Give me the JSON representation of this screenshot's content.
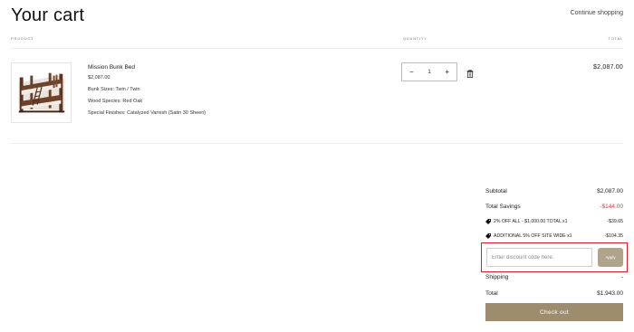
{
  "page": {
    "title": "Your cart",
    "continue_label": "Continue shopping"
  },
  "columns": {
    "product": "PRODUCT",
    "quantity": "QUANTITY",
    "total": "TOTAL"
  },
  "item": {
    "name": "Mission Bunk Bed",
    "price": "$2,087.00",
    "options": [
      "Bunk Sizes: Twin / Twin",
      "Wood Species: Red Oak",
      "Special Finishes: Catalyzed Varnish (Satin 30 Sheen)"
    ],
    "quantity": "1",
    "minus": "−",
    "plus": "+",
    "line_total": "$2,087.00",
    "image_icon": "bunk-bed-photo"
  },
  "summary": {
    "subtotal_label": "Subtotal",
    "subtotal_value": "$2,087.00",
    "savings_label": "Total Savings",
    "savings_value": "-$144.00",
    "discounts": [
      {
        "label": "2% OFF ALL - $1,000.00 TOTAL x1",
        "value": "-$39.65"
      },
      {
        "label": "ADDITIONAL 5% OFF SITE WIDE x1",
        "value": "-$104.35"
      }
    ],
    "discount_placeholder": "Enter discount code here.",
    "discount_value": "",
    "apply_label": "Apply",
    "shipping_label": "Shipping",
    "shipping_value": "-",
    "total_label": "Total",
    "total_value": "$1,943.00",
    "checkout_label": "Check out"
  },
  "colors": {
    "accent": "#9d8c6e",
    "apply": "#b0a38c",
    "savings": "#e03a3a",
    "highlight": "#d8222a"
  }
}
